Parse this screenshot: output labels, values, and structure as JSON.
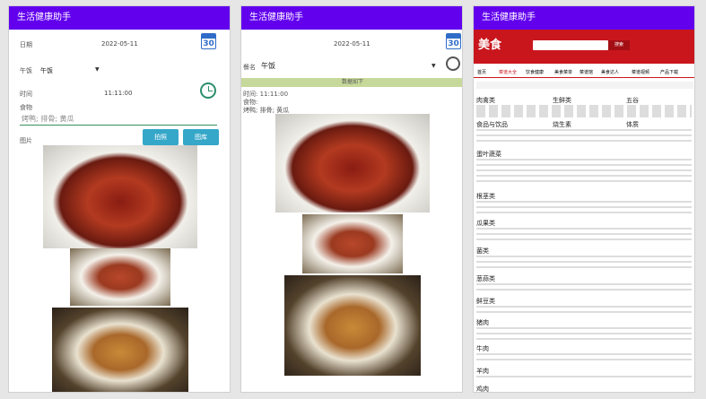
{
  "app": {
    "title": "生活健康助手"
  },
  "screen1": {
    "date_label": "日期",
    "date_value": "2022-05-11",
    "calendar_day": "30",
    "meal_label": "午饭",
    "meal_value": "午饭",
    "time_label": "时间",
    "time_value": "11:11:00",
    "food_label": "食物",
    "food_placeholder": "烤鸭; 排骨; 黄瓜",
    "image_label": "图片",
    "btn_camera": "拍照",
    "btn_gallery": "图库"
  },
  "screen2": {
    "date_value": "2022-05-11",
    "calendar_day": "30",
    "meal_label": "餐名",
    "meal_value": "午饭",
    "banner": "数据如下",
    "time_line": "时间:  11:11:00",
    "food_line": "食物:",
    "food_items": "烤鸭; 排骨; 黄瓜"
  },
  "screen3": {
    "search_button": "搜索",
    "nav": [
      "首页",
      "菜谱大全",
      "饮食健康",
      "美食菜单",
      "菜谱馆",
      "美食达人",
      "菜谱视频",
      "产品下载"
    ],
    "sections": [
      "肉禽类",
      "生鲜类",
      "五谷",
      "食品与饮品",
      "烧生素",
      "体质",
      "蛋叶蔬菜",
      "根茎类",
      "瓜果类",
      "菌类",
      "葱蒜类",
      "鲜豆类",
      "猪肉",
      "牛肉",
      "羊肉",
      "鸡肉"
    ]
  },
  "colors": {
    "appbar": "#6200ee",
    "button": "#35a7c9",
    "site_red": "#c9161d"
  }
}
